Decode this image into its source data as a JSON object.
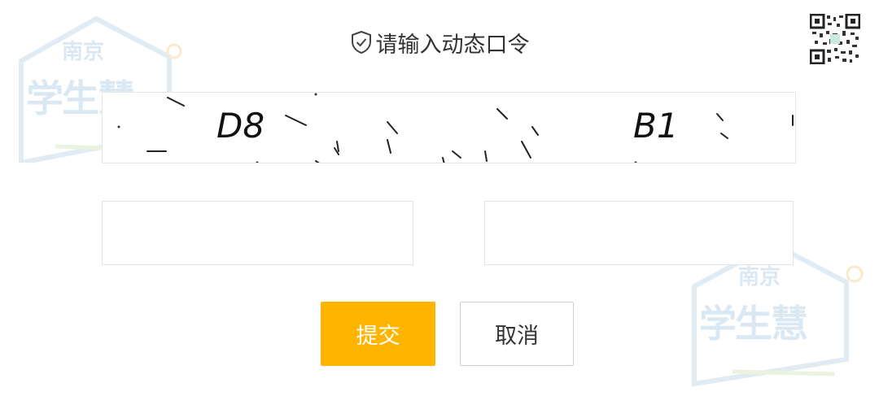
{
  "dialog": {
    "title": "请输入动态口令",
    "captcha_left": "D8",
    "captcha_right": "B1",
    "field_1_value": "",
    "field_2_value": "",
    "submit_label": "提交",
    "cancel_label": "取消"
  },
  "watermark": {
    "top_text": "南京",
    "main_text": "学生慧"
  },
  "icons": {
    "title_icon": "shield-check-icon",
    "corner_image": "qr-code-icon"
  },
  "colors": {
    "submit": "#ffb400",
    "watermark": "#bcd6ea",
    "text": "#333333"
  }
}
